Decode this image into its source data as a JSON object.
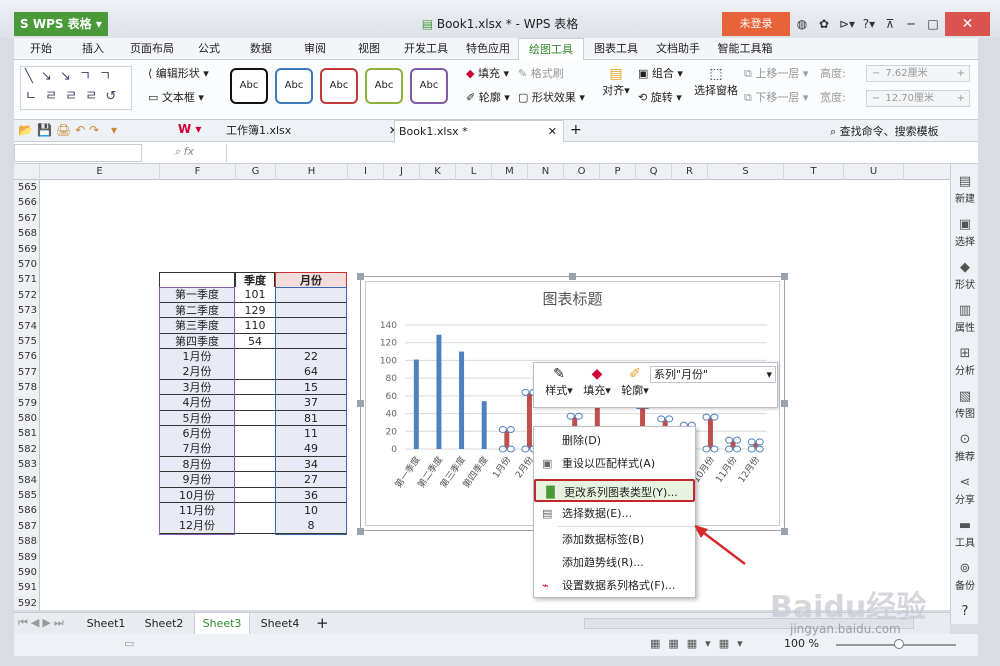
{
  "app": {
    "name": "WPS 表格",
    "title": "Book1.xlsx * - WPS 表格",
    "login": "未登录"
  },
  "menus": [
    "开始",
    "插入",
    "页面布局",
    "公式",
    "数据",
    "审阅",
    "视图",
    "开发工具",
    "特色应用",
    "绘图工具",
    "图表工具",
    "文档助手",
    "智能工具箱"
  ],
  "ribbon": {
    "edit_shape": "编辑形状",
    "textbox": "文本框",
    "style_label": "Abc",
    "fill": "填充",
    "format_painter": "格式刷",
    "outline": "轮廓",
    "shape_effect": "形状效果",
    "align": "对齐",
    "group": "组合",
    "rotate": "旋转",
    "selection_pane": "选择窗格",
    "bring_forward": "上移一层",
    "send_backward": "下移一层",
    "height_label": "高度:",
    "height_value": "7.62厘米",
    "width_label": "宽度:",
    "width_value": "12.70厘米",
    "style_colors": [
      "#111111",
      "#3a7bbf",
      "#c0383a",
      "#8db33a",
      "#7b5aa6"
    ]
  },
  "tabs": {
    "doc1": "工作簿1.xlsx",
    "doc2": "Book1.xlsx *",
    "search": "查找命令、搜索模板"
  },
  "formula": {
    "fx": "fx"
  },
  "columns": [
    "E",
    "F",
    "G",
    "H",
    "I",
    "J",
    "K",
    "L",
    "M",
    "N",
    "O",
    "P",
    "Q",
    "R",
    "S",
    "T",
    "U"
  ],
  "rows": [
    "565",
    "566",
    "567",
    "568",
    "569",
    "570",
    "571",
    "572",
    "573",
    "574",
    "575",
    "576",
    "577",
    "578",
    "579",
    "580",
    "581",
    "582",
    "583",
    "584",
    "585",
    "586",
    "587",
    "588",
    "589",
    "590",
    "591",
    "592"
  ],
  "table": {
    "header_g": "季度",
    "header_h": "月份",
    "quarters": [
      {
        "label": "第一季度",
        "value": "101"
      },
      {
        "label": "第二季度",
        "value": "129"
      },
      {
        "label": "第三季度",
        "value": "110"
      },
      {
        "label": "第四季度",
        "value": "54"
      }
    ],
    "months": [
      {
        "label": "1月份",
        "value": "22"
      },
      {
        "label": "2月份",
        "value": "64"
      },
      {
        "label": "3月份",
        "value": "15"
      },
      {
        "label": "4月份",
        "value": "37"
      },
      {
        "label": "5月份",
        "value": "81"
      },
      {
        "label": "6月份",
        "value": "11"
      },
      {
        "label": "7月份",
        "value": "49"
      },
      {
        "label": "8月份",
        "value": "34"
      },
      {
        "label": "9月份",
        "value": "27"
      },
      {
        "label": "10月份",
        "value": "36"
      },
      {
        "label": "11月份",
        "value": "10"
      },
      {
        "label": "12月份",
        "value": "8"
      }
    ]
  },
  "chart_data": {
    "type": "bar",
    "title": "图表标题",
    "categories": [
      "第一季度",
      "第二季度",
      "第三季度",
      "第四季度",
      "1月份",
      "2月份",
      "3月份",
      "4月份",
      "5月份",
      "6月份",
      "7月份",
      "8月份",
      "9月份",
      "10月份",
      "11月份",
      "12月份"
    ],
    "series": [
      {
        "values": [
          101,
          129,
          110,
          54,
          null,
          null,
          null,
          null,
          null,
          null,
          null,
          null,
          null,
          null,
          null,
          null
        ],
        "color": "#4f81bd"
      },
      {
        "values": [
          null,
          null,
          null,
          null,
          22,
          64,
          15,
          37,
          81,
          11,
          49,
          34,
          27,
          36,
          10,
          8
        ],
        "color": "#c0504d"
      }
    ],
    "yticks": [
      "0",
      "20",
      "40",
      "60",
      "80",
      "100",
      "120",
      "140"
    ],
    "ylim": [
      0,
      140
    ]
  },
  "minibar": {
    "style": "样式",
    "fill": "填充",
    "outline": "轮廓",
    "series_select": "系列\"月份\""
  },
  "context_menu": [
    "删除(D)",
    "重设以匹配样式(A)",
    "更改系列图表类型(Y)...",
    "选择数据(E)...",
    "添加数据标签(B)",
    "添加趋势线(R)...",
    "设置数据系列格式(F)..."
  ],
  "sheets": [
    "Sheet1",
    "Sheet2",
    "Sheet3",
    "Sheet4"
  ],
  "sidebar": [
    "新建",
    "选择",
    "形状",
    "属性",
    "分析",
    "传图",
    "推荐",
    "分享",
    "工具",
    "备份"
  ],
  "status": {
    "zoom": "100 %"
  },
  "watermark": {
    "text": "Baidu经验",
    "url": "jingyan.baidu.com"
  }
}
